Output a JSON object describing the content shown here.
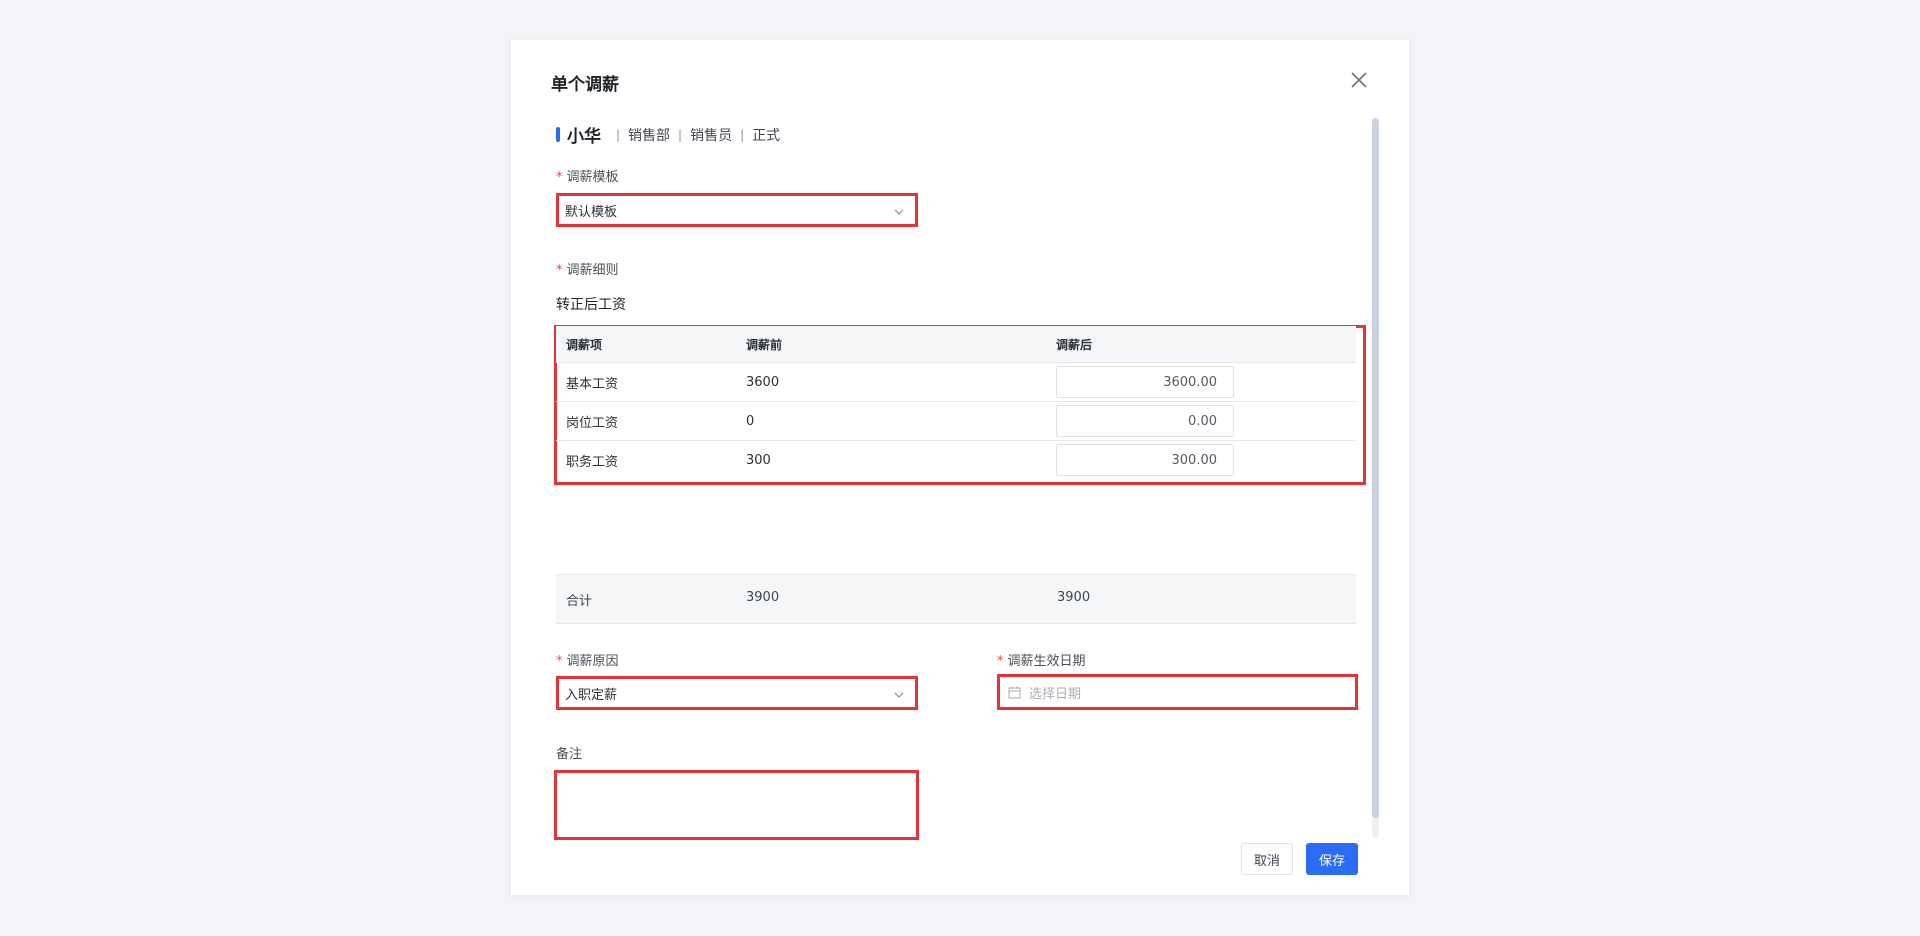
{
  "modal": {
    "title": "单个调薪",
    "employee": {
      "name": "小华",
      "department": "销售部",
      "position": "销售员",
      "status": "正式"
    },
    "template": {
      "label": "调薪模板",
      "value": "默认模板"
    },
    "rules": {
      "label": "调薪细则",
      "section_title": "转正后工资",
      "columns": [
        "调薪项",
        "调薪前",
        "调薪后"
      ],
      "rows": [
        {
          "item": "基本工资",
          "before": "3600",
          "after": "3600.00"
        },
        {
          "item": "岗位工资",
          "before": "0",
          "after": "0.00"
        },
        {
          "item": "职务工资",
          "before": "300",
          "after": "300.00"
        }
      ],
      "total": {
        "label": "合计",
        "before": "3900",
        "after": "3900"
      }
    },
    "reason": {
      "label": "调薪原因",
      "value": "入职定薪"
    },
    "effective_date": {
      "label": "调薪生效日期",
      "placeholder": "选择日期"
    },
    "remark": {
      "label": "备注",
      "value": ""
    },
    "buttons": {
      "cancel": "取消",
      "save": "保存"
    },
    "colors": {
      "accent": "#2b6cf6",
      "required": "#f5463b",
      "highlight_border": "#e3343a"
    }
  }
}
